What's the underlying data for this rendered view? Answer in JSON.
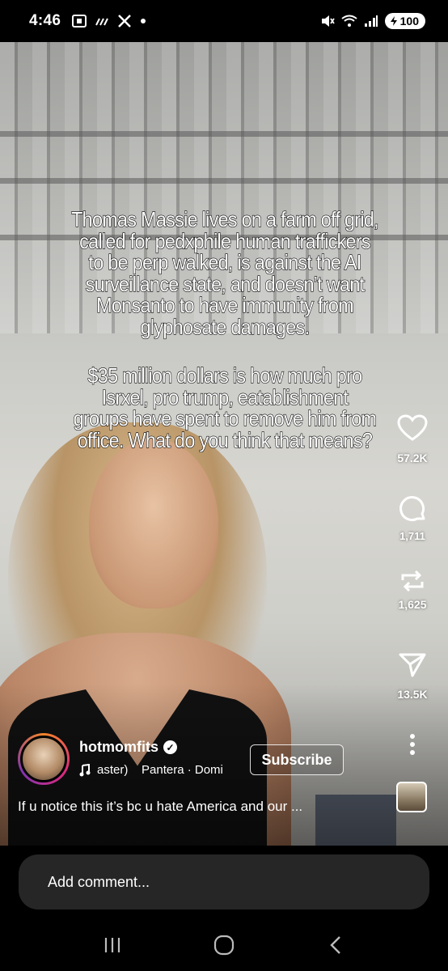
{
  "status_bar": {
    "time": "4:46",
    "left_icons": [
      "screenshot-icon",
      "signal-bars-icon",
      "x-logo-icon",
      "dot-icon"
    ],
    "right_icons": [
      "mute-icon",
      "wifi-icon",
      "cell-signal-icon"
    ],
    "battery": "100"
  },
  "caption": {
    "paragraph1": [
      "Thomas Massie lives on a farm off grid,",
      "called for pedxphile human traffickers",
      "to be perp walked, is against the AI",
      "surveillance state, and doesn’t want",
      "Monsanto to have immunity from",
      "glyphosate damages."
    ],
    "paragraph2": [
      "$35 million dollars is how much pro",
      "Isrxel, pro trump, eatablishment",
      "groups have spent to remove him from",
      "office. What do you think that means?"
    ]
  },
  "actions": {
    "likes": "57.2K",
    "comments": "1,711",
    "reposts": "1,625",
    "shares": "13.5K"
  },
  "account": {
    "username": "hotmomfits",
    "verified": true,
    "music": "aster)    Pantera · Domi",
    "subscribe_label": "Subscribe",
    "description": "If u notice this it’s bc u hate America and our ..."
  },
  "comment_bar": {
    "placeholder": "Add comment..."
  },
  "nav": [
    "recent-apps-icon",
    "home-icon",
    "back-icon"
  ]
}
